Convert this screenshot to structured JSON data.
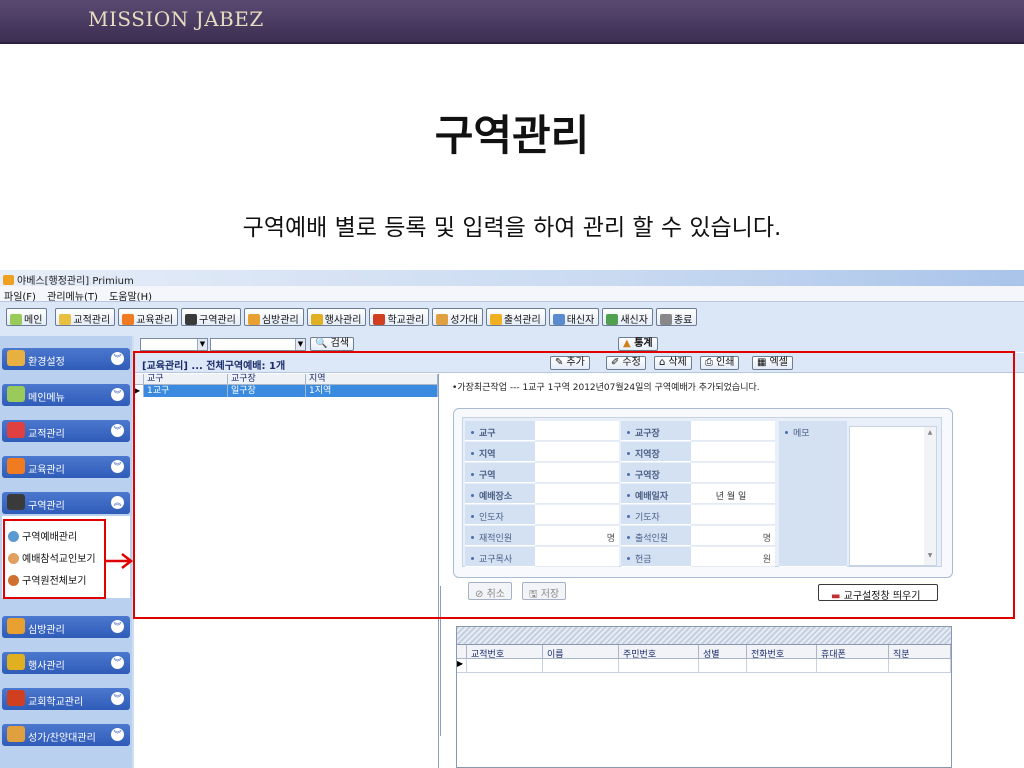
{
  "slide": {
    "brand": "MISSION JABEZ",
    "title": "구역관리",
    "subtitle": "구역예배 별로 등록 및 입력을 하여 관리 할 수 있습니다."
  },
  "app": {
    "window_title": "야베스[행정관리]  Primium",
    "menu": [
      "파일(F)",
      "관리메뉴(T)",
      "도움말(H)"
    ],
    "toolbar": [
      {
        "label": "메인",
        "icon": "home-icon",
        "color": "#9acb5a"
      },
      {
        "label": "교적관리",
        "icon": "book-icon",
        "color": "#e8c040"
      },
      {
        "label": "교육관리",
        "icon": "edu-icon",
        "color": "#f07b20"
      },
      {
        "label": "구역관리",
        "icon": "check-icon",
        "color": "#3a3a3a"
      },
      {
        "label": "심방관리",
        "icon": "visit-icon",
        "color": "#e8a030"
      },
      {
        "label": "행사관리",
        "icon": "event-icon",
        "color": "#e0b020"
      },
      {
        "label": "학교관리",
        "icon": "school-icon",
        "color": "#d04020"
      },
      {
        "label": "성가대",
        "icon": "music-icon",
        "color": "#e0a040"
      },
      {
        "label": "출석관리",
        "icon": "attend-icon",
        "color": "#f0b020"
      },
      {
        "label": "태신자",
        "icon": "people-icon",
        "color": "#5a8ad0"
      },
      {
        "label": "새신자",
        "icon": "newcomer-icon",
        "color": "#50a050"
      },
      {
        "label": "종료",
        "icon": "exit-icon",
        "color": "#888888"
      }
    ],
    "search_label": "검색",
    "stats_label": "통계",
    "sidebar": {
      "groups": [
        {
          "label": "환경설정",
          "icon": "settings-icon",
          "color": "#e8b040"
        },
        {
          "label": "메인메뉴",
          "icon": "main-menu-icon",
          "color": "#9acb5a"
        },
        {
          "label": "교적관리",
          "icon": "book-icon",
          "color": "#e04040"
        },
        {
          "label": "교육관리",
          "icon": "edu-icon",
          "color": "#f07b20"
        },
        {
          "label": "구역관리",
          "icon": "check-icon",
          "color": "#3a3a3a"
        },
        {
          "label": "심방관리",
          "icon": "visit-icon",
          "color": "#e8a030"
        },
        {
          "label": "행사관리",
          "icon": "event-icon",
          "color": "#e0b020"
        },
        {
          "label": "교회학교관리",
          "icon": "school-icon",
          "color": "#d04020"
        },
        {
          "label": "성가/찬양대관리",
          "icon": "music-icon",
          "color": "#e0a040"
        }
      ],
      "sub_items": [
        {
          "label": "구역예배관리",
          "icon": "district-worship-icon",
          "color": "#5a9ad0"
        },
        {
          "label": "예배참석교인보기",
          "icon": "attendee-icon",
          "color": "#e0a060"
        },
        {
          "label": "구역원전체보기",
          "icon": "members-icon",
          "color": "#d07030"
        }
      ]
    },
    "panel": {
      "title": "[교육관리] ... 전체구역예배: 1개",
      "actions": [
        "추가",
        "수정",
        "삭제",
        "인쇄",
        "엑셀"
      ]
    },
    "grid": {
      "columns": [
        "교구",
        "교구장",
        "지역"
      ],
      "rows": [
        [
          "1교구",
          "일구장",
          "1지역"
        ]
      ]
    },
    "info_text": "•가장최근작업 --- 1교구 1구역 2012년07월24일의 구역예배가 추가되었습니다.",
    "form": {
      "left_labels": [
        "교구",
        "지역",
        "구역",
        "예배장소",
        "인도자",
        "재적인원",
        "교구목사"
      ],
      "right_labels": [
        "교구장",
        "지역장",
        "구역장",
        "예배일자",
        "기도자",
        "출석인원",
        "헌금"
      ],
      "memo_label": "메모",
      "date_placeholder": "년  월  일",
      "unit_person": "명",
      "unit_won": "원",
      "cancel_label": "취소",
      "save_label": "저장",
      "setting_label": "교구설정창 띄우기"
    },
    "member_grid": {
      "columns": [
        "교적번호",
        "이름",
        "주민번호",
        "성별",
        "전화번호",
        "휴대폰",
        "직분"
      ]
    }
  }
}
